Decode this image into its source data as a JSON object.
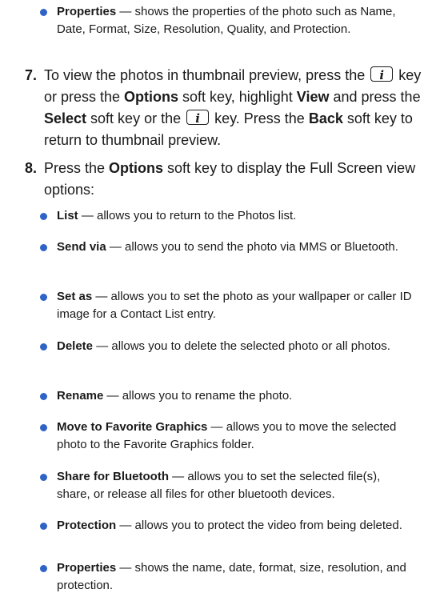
{
  "top_bullet": {
    "term": "Properties",
    "text": " — shows the properties of the photo such as Name, Date, Format, Size, Resolution, Quality, and Protection."
  },
  "step7": {
    "number": "7.",
    "p1": "To view the photos in thumbnail preview, press the ",
    "key_glyph": "i",
    "p2": " key or press the ",
    "b1": "Options",
    "p3": " soft key, highlight ",
    "b2": "View",
    "p4": " and press the ",
    "b3": "Select",
    "p5": " soft key or the ",
    "p6": " key. Press the ",
    "b4": "Back",
    "p7": " soft key to return to thumbnail preview."
  },
  "step8": {
    "number": "8.",
    "p1": "Press the ",
    "b1": "Options",
    "p2": " soft key to display the Full Screen view options:"
  },
  "options": [
    {
      "term": "List",
      "text": " — allows you to return to the Photos list."
    },
    {
      "term": "Send via",
      "text": " — allows you to send the photo via MMS or Bluetooth."
    },
    {
      "term": "Set as",
      "text": " — allows you to set the photo as your wallpaper or caller ID image for a Contact List entry."
    },
    {
      "term": "Delete",
      "text": " — allows you to delete the selected photo or all photos."
    },
    {
      "term": "Rename",
      "text": " — allows you to rename the photo."
    },
    {
      "term": "Move to Favorite Graphics",
      "text": " — allows you to move the selected photo to the Favorite Graphics folder."
    },
    {
      "term": "Share for Bluetooth",
      "text": " — allows you to set the selected file(s), share, or release all files for other bluetooth devices."
    },
    {
      "term": "Protection",
      "text": " — allows you to protect the video from being deleted."
    },
    {
      "term": "Properties",
      "text": " — shows the name, date, format, size, resolution, and protection."
    }
  ]
}
